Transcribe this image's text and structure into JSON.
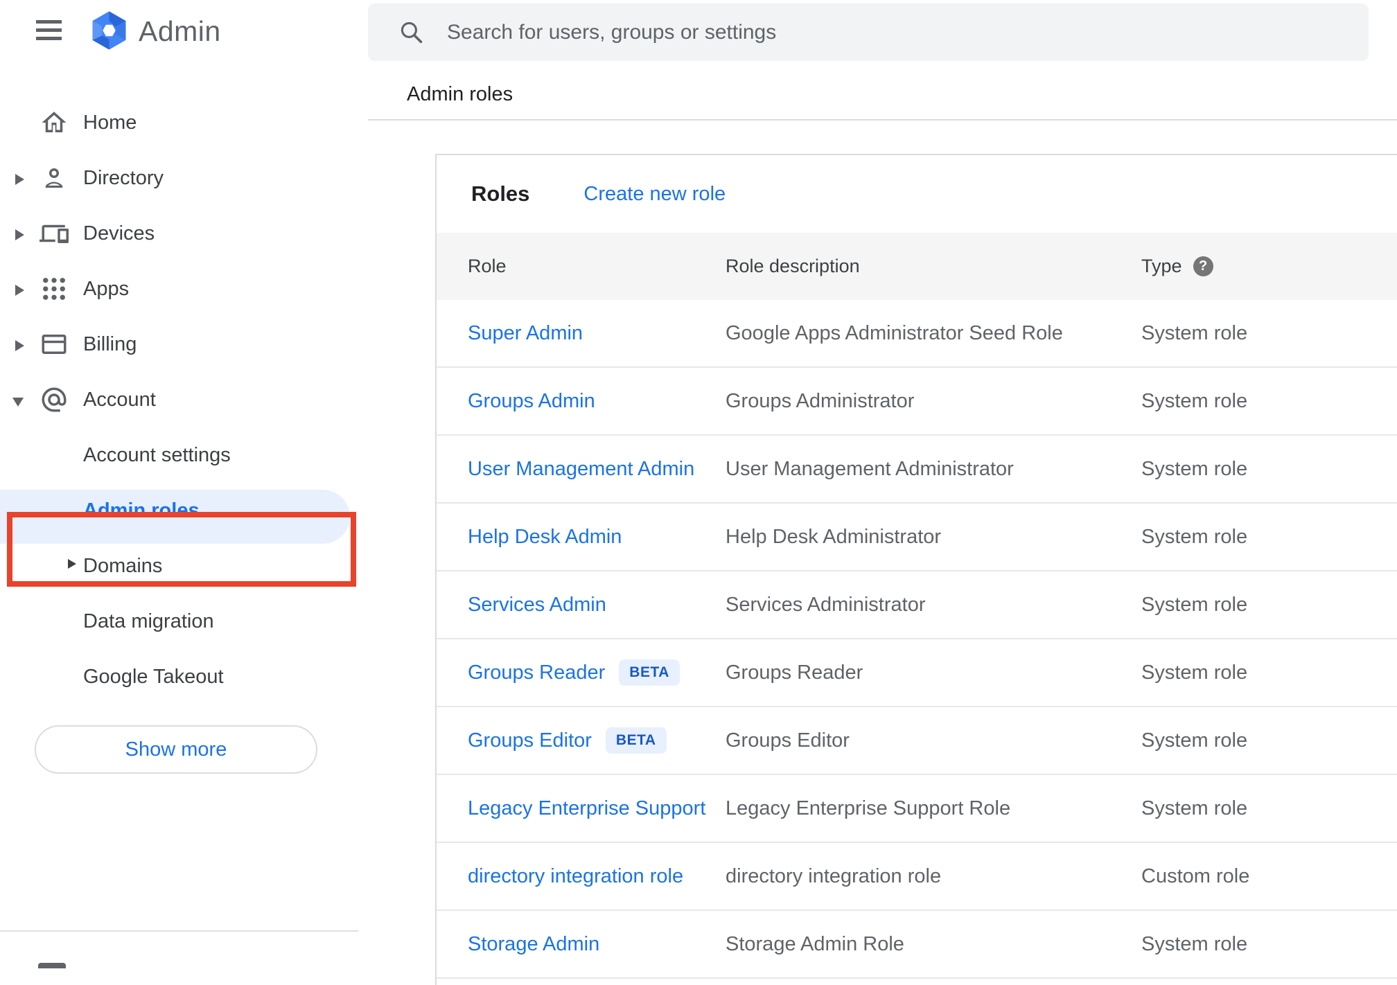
{
  "app": {
    "product": "Admin",
    "logo_icon": "google-admin-hexagon-logo",
    "menu_icon": "hamburger-menu-icon"
  },
  "topbar": {
    "search_icon": "search-icon",
    "search_placeholder": "Search for users, groups or settings"
  },
  "breadcrumb": {
    "label": "Admin roles"
  },
  "sidebar": {
    "items": [
      {
        "label": "Home",
        "icon": "home-icon",
        "caret": "none"
      },
      {
        "label": "Directory",
        "icon": "person-icon",
        "caret": "collapsed"
      },
      {
        "label": "Devices",
        "icon": "devices-icon",
        "caret": "collapsed"
      },
      {
        "label": "Apps",
        "icon": "apps-grid-icon",
        "caret": "collapsed"
      },
      {
        "label": "Billing",
        "icon": "credit-card-icon",
        "caret": "collapsed"
      },
      {
        "label": "Account",
        "icon": "at-sign-icon",
        "caret": "expanded"
      }
    ],
    "account_children": [
      {
        "label": "Account settings",
        "selected": false,
        "caret": "none"
      },
      {
        "label": "Admin roles",
        "selected": true,
        "caret": "none",
        "annotated": true
      },
      {
        "label": "Domains",
        "selected": false,
        "caret": "collapsed"
      },
      {
        "label": "Data migration",
        "selected": false,
        "caret": "none"
      },
      {
        "label": "Google Takeout",
        "selected": false,
        "caret": "none"
      }
    ],
    "show_more_label": "Show more",
    "selected_bg": "#e8f0fe",
    "selected_color": "#1a73e8",
    "annotation_color": "#e8432b"
  },
  "content": {
    "panel_title": "Roles",
    "create_link": "Create new role",
    "table": {
      "columns": [
        "Role",
        "Role description",
        "Type"
      ],
      "type_help_icon": "help-icon",
      "beta_badge_label": "BETA",
      "rows": [
        {
          "role": "Super Admin",
          "beta": false,
          "description": "Google Apps Administrator Seed Role",
          "type": "System role"
        },
        {
          "role": "Groups Admin",
          "beta": false,
          "description": "Groups Administrator",
          "type": "System role"
        },
        {
          "role": "User Management Admin",
          "beta": false,
          "description": "User Management Administrator",
          "type": "System role"
        },
        {
          "role": "Help Desk Admin",
          "beta": false,
          "description": "Help Desk Administrator",
          "type": "System role"
        },
        {
          "role": "Services Admin",
          "beta": false,
          "description": "Services Administrator",
          "type": "System role"
        },
        {
          "role": "Groups Reader",
          "beta": true,
          "description": "Groups Reader",
          "type": "System role"
        },
        {
          "role": "Groups Editor",
          "beta": true,
          "description": "Groups Editor",
          "type": "System role"
        },
        {
          "role": "Legacy Enterprise Support",
          "beta": false,
          "description": "Legacy Enterprise Support Role",
          "type": "System role"
        },
        {
          "role": "directory integration role",
          "beta": false,
          "description": "directory integration role",
          "type": "Custom role"
        },
        {
          "role": "Storage Admin",
          "beta": false,
          "description": "Storage Admin Role",
          "type": "System role"
        }
      ]
    }
  },
  "colors": {
    "link_blue": "#1a73e8",
    "selected_bg": "#e8f0fe",
    "annotation_red": "#e8432b",
    "table_header_bg": "#f5f5f5",
    "text_gray": "#5f6368",
    "text_dark": "#202124"
  }
}
